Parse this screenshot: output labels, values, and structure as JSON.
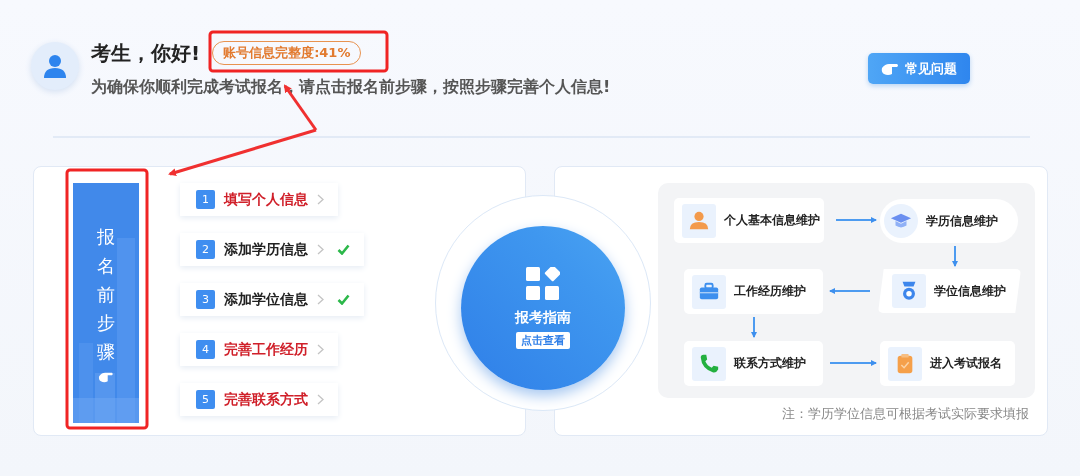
{
  "greeting": {
    "title": "考生，你好!",
    "completeness_badge": "账号信息完整度:41%",
    "subtitle": "为确保你顺利完成考试报名，请点击报名前步骤，按照步骤完善个人信息!"
  },
  "faq_button": "常见问题",
  "steps_banner": "报名前步骤",
  "steps": [
    {
      "number": "1",
      "label": "填写个人信息",
      "done": false
    },
    {
      "number": "2",
      "label": "添加学历信息",
      "done": true
    },
    {
      "number": "3",
      "label": "添加学位信息",
      "done": true
    },
    {
      "number": "4",
      "label": "完善工作经历",
      "done": false
    },
    {
      "number": "5",
      "label": "完善联系方式",
      "done": false
    }
  ],
  "guide": {
    "title": "报考指南",
    "action": "点击查看"
  },
  "flow": {
    "nodes": [
      {
        "label": "个人基本信息维护",
        "kind": "person"
      },
      {
        "label": "学历信息维护",
        "kind": "cap"
      },
      {
        "label": "工作经历维护",
        "kind": "briefcase"
      },
      {
        "label": "学位信息维护",
        "kind": "medal"
      },
      {
        "label": "联系方式维护",
        "kind": "phone"
      },
      {
        "label": "进入考试报名",
        "kind": "clipboard"
      }
    ],
    "note": "注：学历学位信息可根据考试实际要求填报"
  }
}
